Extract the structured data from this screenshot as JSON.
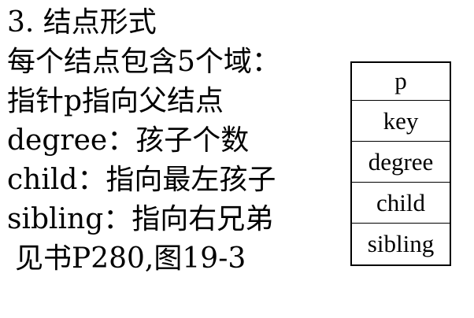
{
  "lines": [
    "3. 结点形式",
    "每个结点包含5个域：",
    "指针p指向父结点",
    "degree：孩子个数",
    "child：指向最左孩子",
    "sibling：指向右兄弟",
    "见书P280,图19-3"
  ],
  "node_fields": [
    "p",
    "key",
    "degree",
    "child",
    "sibling"
  ]
}
